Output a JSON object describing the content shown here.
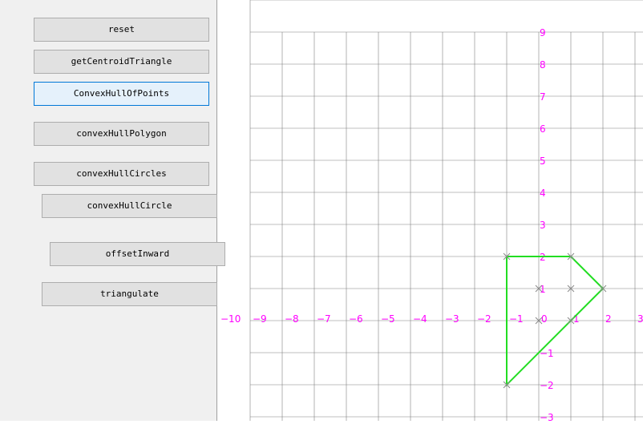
{
  "buttons": [
    {
      "key": "reset",
      "label": "reset",
      "active": false
    },
    {
      "key": "getCentroidTriangle",
      "label": "getCentroidTriangle",
      "active": false
    },
    {
      "key": "ConvexHullOfPoints",
      "label": "ConvexHullOfPoints",
      "active": true
    },
    {
      "key": "convexHullPolygon",
      "label": "convexHullPolygon",
      "active": false
    },
    {
      "key": "convexHullCircles",
      "label": "convexHullCircles",
      "active": false
    },
    {
      "key": "convexHullCircle",
      "label": "convexHullCircle",
      "active": false
    },
    {
      "key": "offsetInward",
      "label": "offsetInward",
      "active": false
    },
    {
      "key": "triangulate",
      "label": "triangulate",
      "active": false
    }
  ],
  "plot": {
    "x_ticks": [
      -10,
      -9,
      -8,
      -7,
      -6,
      -5,
      -4,
      -3,
      -2,
      -1,
      0,
      1,
      2,
      3
    ],
    "y_ticks": [
      9,
      8,
      7,
      6,
      5,
      4,
      3,
      2,
      1,
      -1,
      -2,
      -3
    ],
    "axis_label_color": "#ff00ff",
    "grid_color": "#808080",
    "hull_color": "#22dd22",
    "marker_color": "#888888",
    "points": [
      [
        -1,
        2
      ],
      [
        1,
        2
      ],
      [
        2,
        1
      ],
      [
        -1,
        -2
      ],
      [
        0,
        1
      ],
      [
        1,
        1
      ],
      [
        0,
        0
      ],
      [
        1,
        0
      ]
    ],
    "hull": [
      [
        -1,
        2
      ],
      [
        1,
        2
      ],
      [
        2,
        1
      ],
      [
        -1,
        -2
      ]
    ]
  }
}
